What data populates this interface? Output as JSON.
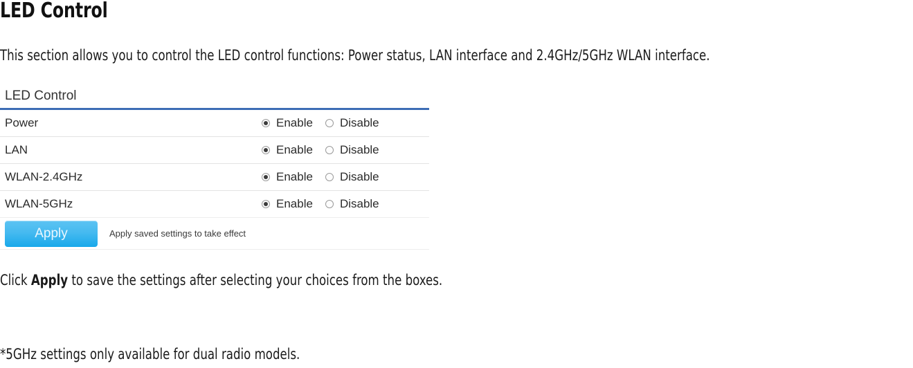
{
  "document": {
    "heading": "LED Control",
    "intro": "This section allows you to control the LED control functions: Power status, LAN interface and 2.4GHz/5GHz WLAN interface.",
    "click_apply_prefix": "Click ",
    "click_apply_bold": "Apply",
    "click_apply_suffix": " to save the settings after selecting your choices from the boxes.",
    "footnote": "*5GHz settings only available for dual radio models."
  },
  "panel": {
    "title": "LED Control",
    "accent_color": "#3c6db5",
    "rows": [
      {
        "label": "Power",
        "enable_label": "Enable",
        "disable_label": "Disable",
        "selected": "Enable"
      },
      {
        "label": "LAN",
        "enable_label": "Enable",
        "disable_label": "Disable",
        "selected": "Enable"
      },
      {
        "label": "WLAN-2.4GHz",
        "enable_label": "Enable",
        "disable_label": "Disable",
        "selected": "Enable"
      },
      {
        "label": "WLAN-5GHz",
        "enable_label": "Enable",
        "disable_label": "Disable",
        "selected": "Enable"
      }
    ],
    "apply": {
      "button_label": "Apply",
      "hint": "Apply saved settings to take effect",
      "button_color_top": "#5cc3f2",
      "button_color_bottom": "#18a8ea"
    }
  }
}
